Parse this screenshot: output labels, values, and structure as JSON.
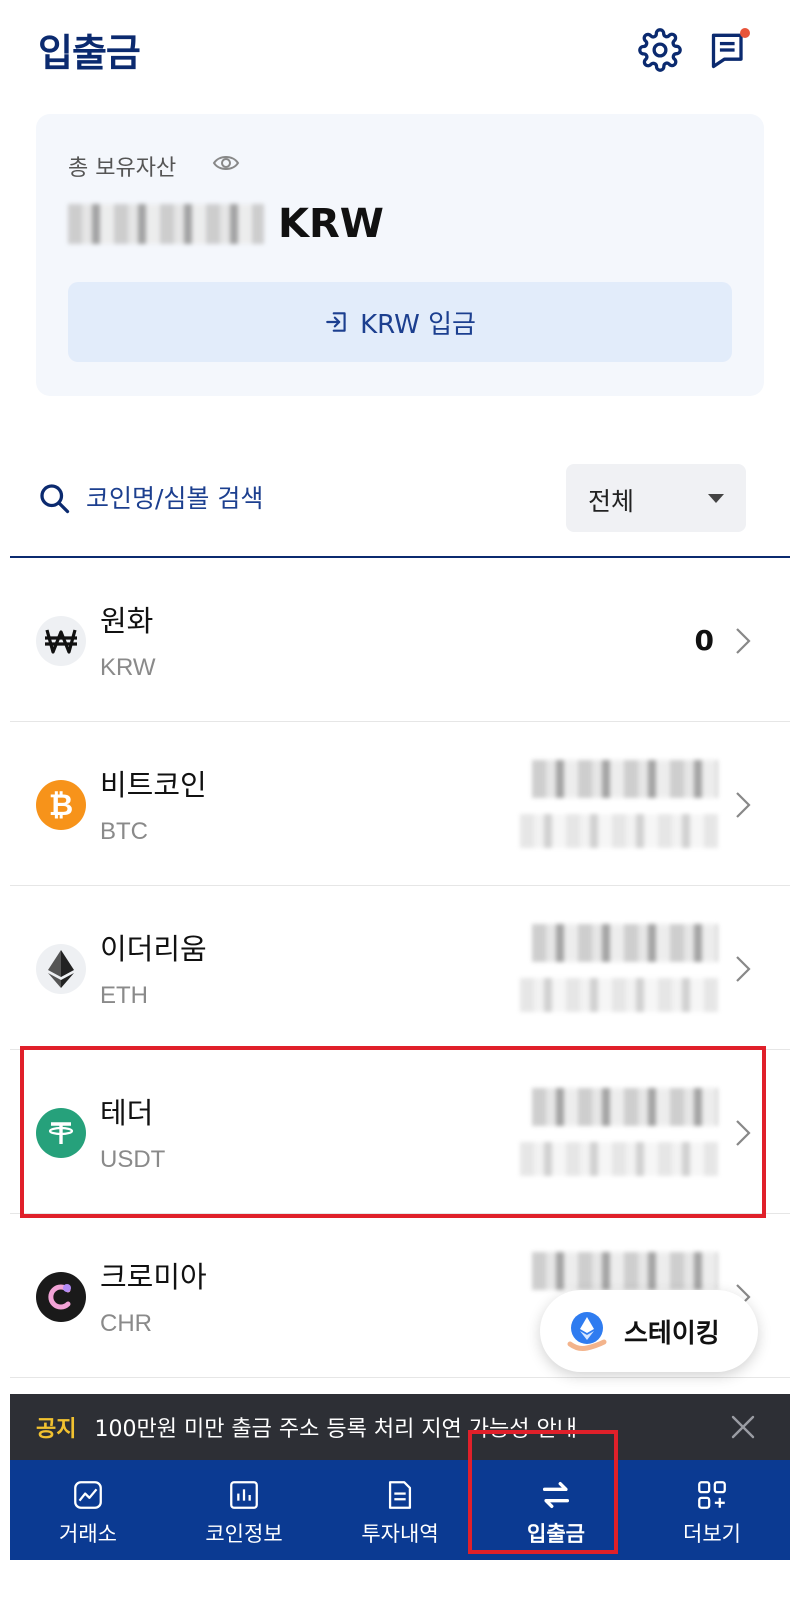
{
  "header": {
    "title": "입출금",
    "settings_icon": "gear-icon",
    "messages_icon": "chat-icon"
  },
  "asset": {
    "label": "총 보유자산",
    "currency": "KRW",
    "deposit_label": "KRW 입금"
  },
  "search": {
    "placeholder": "코인명/심볼 검색",
    "filter_value": "전체"
  },
  "coins": [
    {
      "name": "원화",
      "symbol": "KRW",
      "balance": "0",
      "icon": "won-icon",
      "color": "#f0f1f4"
    },
    {
      "name": "비트코인",
      "symbol": "BTC",
      "icon": "bitcoin-icon",
      "color": "#f7931a"
    },
    {
      "name": "이더리움",
      "symbol": "ETH",
      "icon": "ethereum-icon",
      "color": "#f0f1f4"
    },
    {
      "name": "테더",
      "symbol": "USDT",
      "icon": "tether-icon",
      "color": "#26a17b"
    },
    {
      "name": "크로미아",
      "symbol": "CHR",
      "icon": "chromia-icon",
      "color": "#1a1a1a"
    }
  ],
  "staking": {
    "label": "스테이킹"
  },
  "notice": {
    "tag": "공지",
    "text": "100만원 미만 출금 주소 등록 처리 지연 가능성 안내"
  },
  "nav": {
    "items": [
      {
        "label": "거래소",
        "icon": "chart-icon"
      },
      {
        "label": "코인정보",
        "icon": "bar-chart-icon"
      },
      {
        "label": "투자내역",
        "icon": "document-icon"
      },
      {
        "label": "입출금",
        "icon": "transfer-icon"
      },
      {
        "label": "더보기",
        "icon": "grid-plus-icon"
      }
    ],
    "active_index": 3
  },
  "colors": {
    "brand": "#0b3a92",
    "title": "#0b2a6f",
    "highlight": "#e0202a"
  }
}
